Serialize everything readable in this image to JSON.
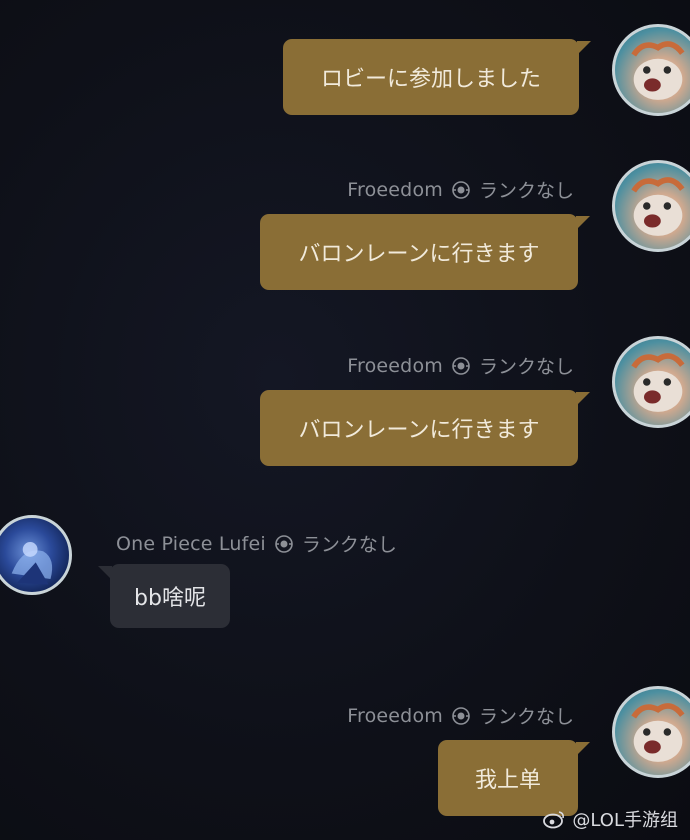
{
  "messages": [
    {
      "side": "right",
      "sender": "",
      "rank": "",
      "text": "ロビーに参加しました"
    },
    {
      "side": "right",
      "sender": "Froeedom",
      "rank": "ランクなし",
      "text": "バロンレーンに行きます"
    },
    {
      "side": "right",
      "sender": "Froeedom",
      "rank": "ランクなし",
      "text": "バロンレーンに行きます"
    },
    {
      "side": "left",
      "sender": "One Piece Lufei",
      "rank": "ランクなし",
      "text": "bb啥呢"
    },
    {
      "side": "right",
      "sender": "Froeedom",
      "rank": "ランクなし",
      "text": "我上单"
    }
  ],
  "watermark": {
    "text": "@LOL手游组",
    "icon": "weibo-icon"
  },
  "colors": {
    "background": "#0f1119",
    "outgoing_bubble": "#8a6e36",
    "incoming_bubble": "#2c2e36",
    "meta_text": "#8d9097"
  }
}
